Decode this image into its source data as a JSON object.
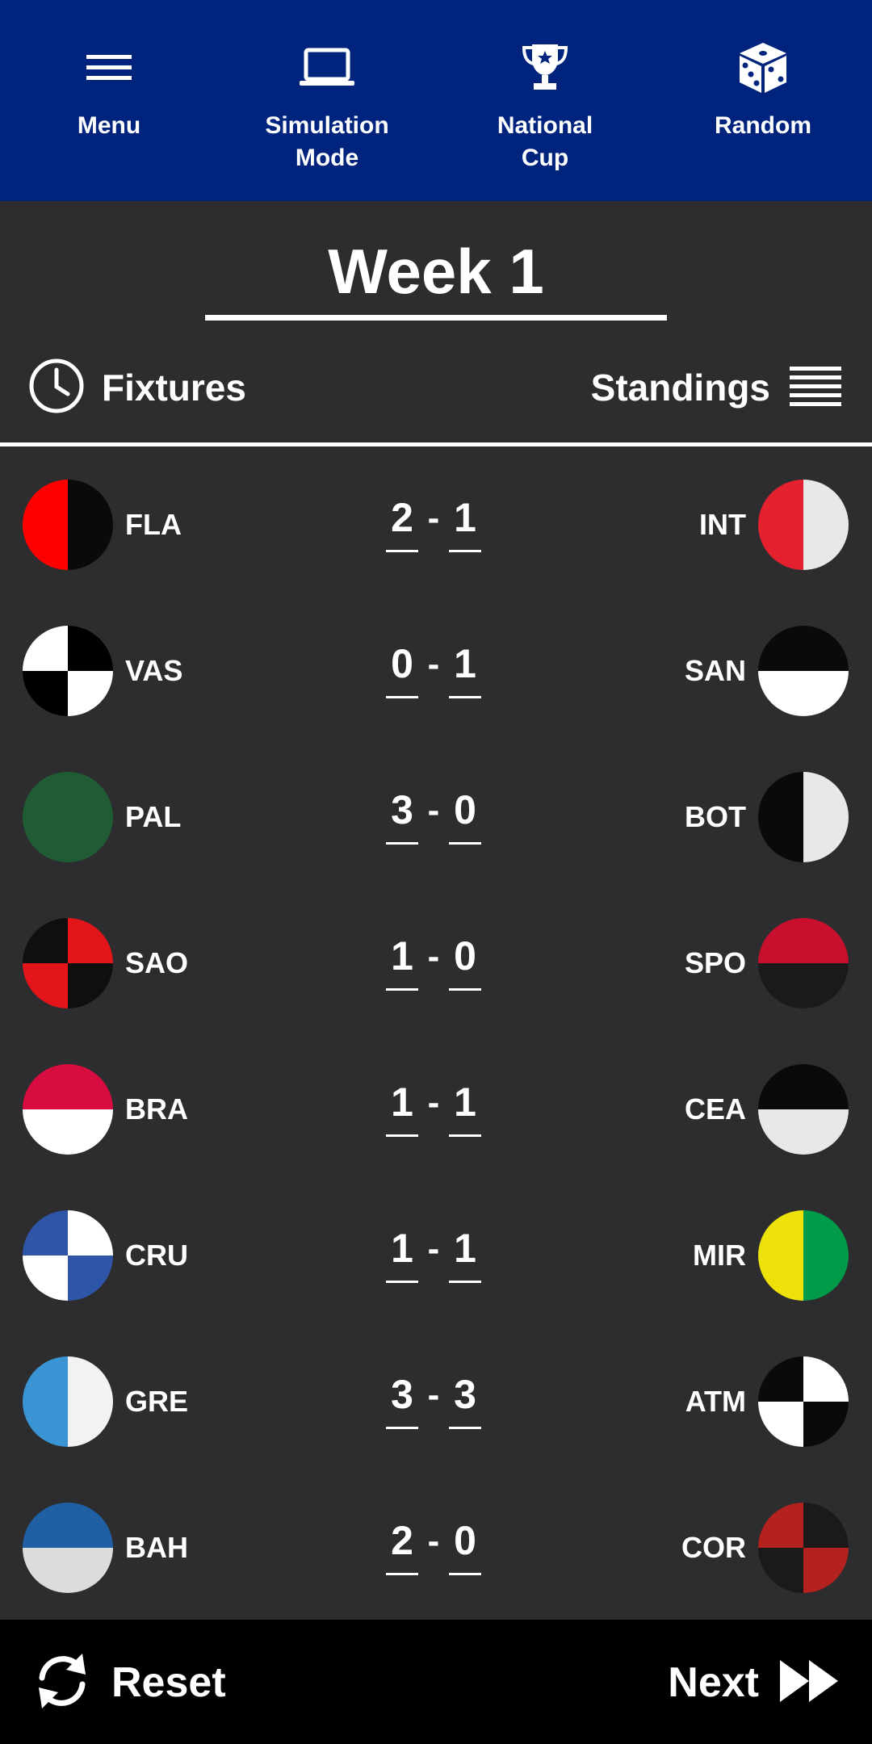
{
  "nav": {
    "items": [
      {
        "label": "Menu",
        "icon": "hamburger-menu-icon"
      },
      {
        "label": "Simulation\nMode",
        "icon": "laptop-icon"
      },
      {
        "label": "National\nCup",
        "icon": "trophy-icon"
      },
      {
        "label": "Random",
        "icon": "dice-icon"
      }
    ],
    "background": "#00247d"
  },
  "week": {
    "title": "Week 1"
  },
  "tabs": {
    "fixtures": {
      "label": "Fixtures",
      "icon": "clock-icon"
    },
    "standings": {
      "label": "Standings",
      "icon": "list-lines-icon"
    }
  },
  "fixtures": [
    {
      "home": {
        "abbr": "FLA",
        "crest": "split-v",
        "colors": [
          "#ff0000",
          "#0a0a0a"
        ]
      },
      "home_score": "2",
      "away": {
        "abbr": "INT",
        "crest": "split-v",
        "colors": [
          "#e3212f",
          "#e8e8e8"
        ]
      },
      "away_score": "1"
    },
    {
      "home": {
        "abbr": "VAS",
        "crest": "quarters",
        "colors": [
          "#ffffff",
          "#000000"
        ]
      },
      "home_score": "0",
      "away": {
        "abbr": "SAN",
        "crest": "split-h",
        "colors": [
          "#0a0a0a",
          "#ffffff"
        ]
      },
      "away_score": "1"
    },
    {
      "home": {
        "abbr": "PAL",
        "crest": "solid",
        "colors": [
          "#1f5c33"
        ]
      },
      "home_score": "3",
      "away": {
        "abbr": "BOT",
        "crest": "split-v",
        "colors": [
          "#0a0a0a",
          "#e8e8e8"
        ]
      },
      "away_score": "0"
    },
    {
      "home": {
        "abbr": "SAO",
        "crest": "quarters",
        "colors": [
          "#0f0f0f",
          "#e3151a"
        ]
      },
      "home_score": "1",
      "away": {
        "abbr": "SPO",
        "crest": "split-h",
        "colors": [
          "#c8102e",
          "#1a1a1a"
        ]
      },
      "away_score": "0"
    },
    {
      "home": {
        "abbr": "BRA",
        "crest": "split-h",
        "colors": [
          "#d90c3f",
          "#ffffff"
        ]
      },
      "home_score": "1",
      "away": {
        "abbr": "CEA",
        "crest": "split-h",
        "colors": [
          "#0a0a0a",
          "#e8e8e8"
        ]
      },
      "away_score": "1"
    },
    {
      "home": {
        "abbr": "CRU",
        "crest": "quarters",
        "colors": [
          "#2e55a8",
          "#ffffff"
        ]
      },
      "home_score": "1",
      "away": {
        "abbr": "MIR",
        "crest": "split-v",
        "colors": [
          "#ede10a",
          "#009b48"
        ]
      },
      "away_score": "1"
    },
    {
      "home": {
        "abbr": "GRE",
        "crest": "split-v",
        "colors": [
          "#3a93d3",
          "#f2f2f2"
        ]
      },
      "home_score": "3",
      "away": {
        "abbr": "ATM",
        "crest": "quarters",
        "colors": [
          "#0a0a0a",
          "#ffffff"
        ]
      },
      "away_score": "3"
    },
    {
      "home": {
        "abbr": "BAH",
        "crest": "split-h",
        "colors": [
          "#1f5fa3",
          "#dcdcdc"
        ]
      },
      "home_score": "2",
      "away": {
        "abbr": "COR",
        "crest": "quarters",
        "colors": [
          "#b3221f",
          "#1a1a1a"
        ]
      },
      "away_score": "0"
    }
  ],
  "bottom": {
    "reset": {
      "label": "Reset",
      "icon": "refresh-icon"
    },
    "next": {
      "label": "Next",
      "icon": "fast-forward-icon"
    }
  }
}
